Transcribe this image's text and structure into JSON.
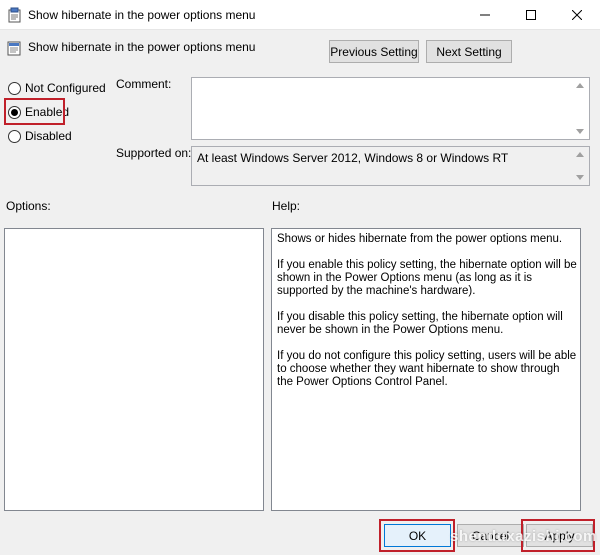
{
  "window": {
    "title": "Show hibernate in the power options menu"
  },
  "header": {
    "policy_name": "Show hibernate in the power options menu",
    "prev_label": "Previous Setting",
    "next_label": "Next Setting"
  },
  "state": {
    "options": [
      {
        "label": "Not Configured",
        "checked": false
      },
      {
        "label": "Enabled",
        "checked": true
      },
      {
        "label": "Disabled",
        "checked": false
      }
    ]
  },
  "comment": {
    "label": "Comment:",
    "value": ""
  },
  "supported": {
    "label": "Supported on:",
    "value": "At least Windows Server 2012, Windows 8 or Windows RT"
  },
  "options_label": "Options:",
  "help": {
    "label": "Help:",
    "paragraphs": [
      "Shows or hides hibernate from the power options menu.",
      "If you enable this policy setting, the hibernate option will be shown in the Power Options menu (as long as it is supported by the machine's hardware).",
      "If you disable this policy setting, the hibernate option will never be shown in the Power Options menu.",
      "If you do not configure this policy setting, users will be able to choose whether they want hibernate to show through the Power Options Control Panel."
    ]
  },
  "footer": {
    "ok_label": "OK",
    "cancel_label": "Cancel",
    "apply_label": "Apply"
  },
  "watermark": "shenduxazishi.com",
  "colors": {
    "highlight_red": "#c0202a",
    "ok_border": "#0078d7"
  },
  "icons": {
    "app": "policy-icon",
    "header": "policy-document-icon"
  }
}
